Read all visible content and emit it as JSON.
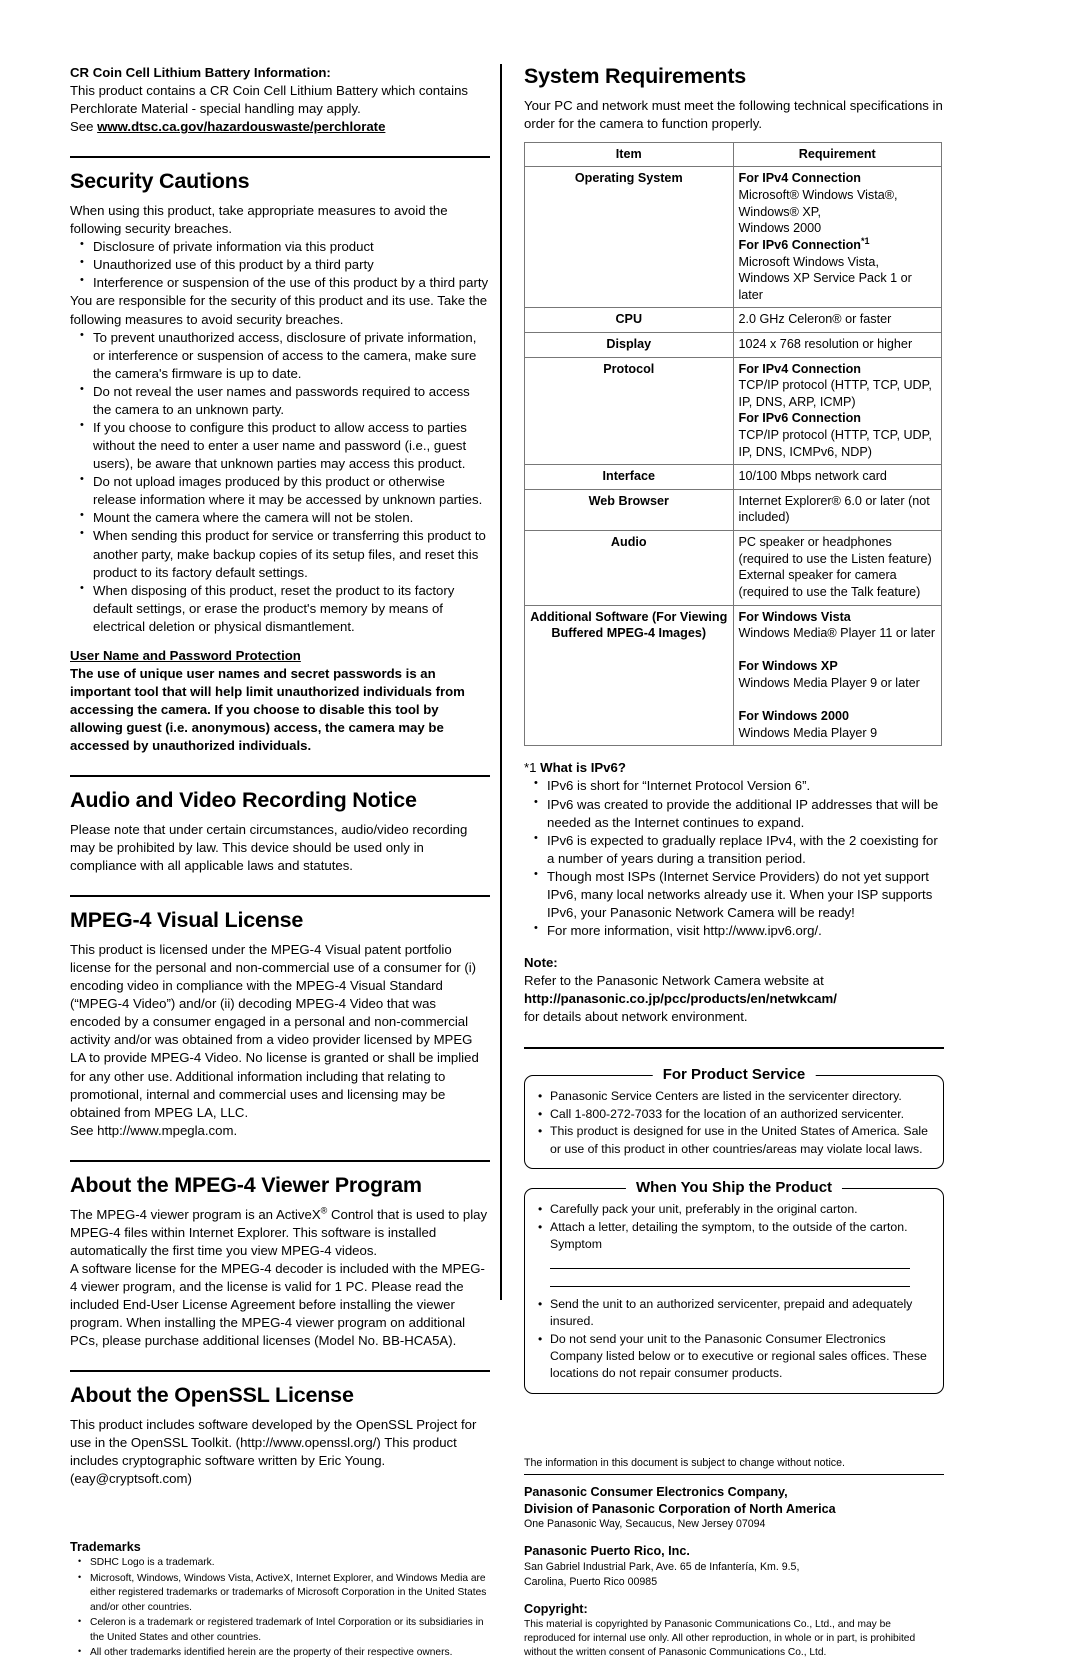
{
  "left_column": {
    "battery_notice": {
      "heading": "CR Coin Cell Lithium Battery Information:",
      "line1": "This product contains a CR Coin Cell Lithium Battery which contains",
      "line2": "Perchlorate Material - special handling may apply.",
      "see_label": "See ",
      "url": "www.dtsc.ca.gov/hazardouswaste/perchlorate"
    },
    "security_cautions": {
      "title": "Security Cautions",
      "intro": "When using this product, take appropriate measures to avoid the following security breaches.",
      "breaches": [
        "Disclosure of private information via this product",
        "Unauthorized use of this product by a third party",
        "Interference or suspension of the use of this product by a third party"
      ],
      "responsibility": "You are responsible for the security of this product and its use. Take the following measures to avoid security breaches.",
      "measures": [
        "To prevent unauthorized access, disclosure of private information, or interference or suspension of access to the camera, make sure the camera's firmware is up to date.",
        "Do not reveal the user names and passwords required to access the camera to an unknown party.",
        "If you choose to configure this product to allow access to parties without the need to enter a user name and password (i.e., guest users), be aware that unknown parties may access this product.",
        "Do not upload images produced by this product or otherwise release information where it may be accessed by unknown parties.",
        "Mount the camera where the camera will not be stolen.",
        "When sending this product for service or transferring this product to another party, make backup copies of its setup files, and reset this product to its factory default settings.",
        "When disposing of this product, reset the product to its factory default settings, or erase the product's memory by means of electrical deletion or physical dismantlement."
      ],
      "password_heading": "User Name and Password Protection",
      "password_body": "The use of unique user names and secret passwords is an important tool that will help limit unauthorized individuals from accessing the camera. If you choose to disable this tool by allowing guest (i.e. anonymous) access, the camera may be accessed by unauthorized individuals."
    },
    "av_recording": {
      "title": "Audio and Video Recording Notice",
      "body": "Please note that under certain circumstances, audio/video recording may be prohibited by law. This device should be used only in compliance with all applicable laws and statutes."
    },
    "mpeg4_license": {
      "title": "MPEG-4 Visual License",
      "body": "This product is licensed under the MPEG-4 Visual patent portfolio license for the personal and non-commercial use of a consumer for (i) encoding video in compliance with the MPEG-4 Visual Standard (“MPEG-4 Video”) and/or (ii) decoding MPEG-4 Video that was encoded by a consumer engaged in a personal and non-commercial activity and/or was obtained from a video provider licensed by MPEG LA to provide MPEG-4 Video. No license is granted or shall be implied for any other use. Additional information including that relating to promotional, internal and commercial uses and licensing may be obtained from MPEG LA, LLC.",
      "see": "See http://www.mpegla.com."
    },
    "mpeg4_viewer": {
      "title": "About the MPEG-4 Viewer Program",
      "para1_a": "The MPEG-4 viewer program is an ActiveX",
      "para1_b": " Control that is used to play MPEG-4 files within Internet Explorer. This software is installed automatically the first time you view MPEG-4 videos.",
      "para2": "A software license for the MPEG-4 decoder is included with the MPEG-4 viewer program, and the license is valid for 1 PC. Please read the included End-User License Agreement before installing the viewer program. When installing the MPEG-4 viewer program on additional PCs, please purchase additional licenses (Model No. BB-HCA5A)."
    },
    "openssl": {
      "title": "About the OpenSSL License",
      "body": "This product includes software developed by the OpenSSL Project for use in the OpenSSL Toolkit. (http://www.openssl.org/) This product includes cryptographic software written by Eric Young. (eay@cryptsoft.com)"
    },
    "trademarks": {
      "title": "Trademarks",
      "items": [
        "SDHC Logo is a trademark.",
        "Microsoft, Windows, Windows Vista, ActiveX, Internet Explorer, and Windows Media are either registered trademarks or trademarks of Microsoft Corporation in the United States and/or other countries.",
        "Celeron is a trademark or registered trademark of Intel Corporation or its subsidiaries in the United States and other countries.",
        "All other trademarks identified herein are the property of their respective owners."
      ]
    }
  },
  "right_column": {
    "system_requirements": {
      "title": "System Requirements",
      "intro": "Your PC and network must meet the following technical specifications in order for the camera to function properly.",
      "table": {
        "headers": [
          "Item",
          "Requirement"
        ],
        "rows": [
          {
            "item": "Operating System",
            "requirement_lines": [
              {
                "text": "For IPv4 Connection",
                "bold": true
              },
              {
                "text": "Microsoft® Windows Vista®, Windows® XP,",
                "bold": false
              },
              {
                "text": "Windows 2000",
                "bold": false
              },
              {
                "text": "For IPv6 Connection*1",
                "bold": true
              },
              {
                "text": "Microsoft Windows Vista,",
                "bold": false
              },
              {
                "text": "Windows XP Service Pack 1 or later",
                "bold": false
              }
            ]
          },
          {
            "item": "CPU",
            "requirement_lines": [
              {
                "text": "2.0 GHz Celeron® or faster",
                "bold": false
              }
            ]
          },
          {
            "item": "Display",
            "requirement_lines": [
              {
                "text": "1024 x 768 resolution or higher",
                "bold": false
              }
            ]
          },
          {
            "item": "Protocol",
            "requirement_lines": [
              {
                "text": "For IPv4 Connection",
                "bold": true
              },
              {
                "text": "TCP/IP protocol (HTTP, TCP, UDP, IP, DNS, ARP, ICMP)",
                "bold": false
              },
              {
                "text": "For IPv6 Connection",
                "bold": true
              },
              {
                "text": "TCP/IP protocol (HTTP, TCP, UDP, IP, DNS, ICMPv6, NDP)",
                "bold": false
              }
            ]
          },
          {
            "item": "Interface",
            "requirement_lines": [
              {
                "text": "10/100 Mbps network card",
                "bold": false
              }
            ]
          },
          {
            "item": "Web Browser",
            "requirement_lines": [
              {
                "text": "Internet Explorer® 6.0 or later (not included)",
                "bold": false
              }
            ]
          },
          {
            "item": "Audio",
            "requirement_lines": [
              {
                "text": "PC speaker or headphones (required to use the Listen feature)",
                "bold": false
              },
              {
                "text": "External speaker for camera (required to use the Talk feature)",
                "bold": false
              }
            ]
          },
          {
            "item": "Additional Software (For Viewing Buffered MPEG-4 Images)",
            "requirement_lines": [
              {
                "text": "For Windows Vista",
                "bold": true
              },
              {
                "text": "Windows Media® Player 11 or later",
                "bold": false
              },
              {
                "text": "",
                "bold": false
              },
              {
                "text": "For Windows XP",
                "bold": true
              },
              {
                "text": "Windows Media Player 9 or later",
                "bold": false
              },
              {
                "text": "",
                "bold": false
              },
              {
                "text": "For Windows 2000",
                "bold": true
              },
              {
                "text": "Windows Media Player 9",
                "bold": false
              }
            ]
          }
        ]
      },
      "footnote": {
        "marker": "*1",
        "heading": "What is IPv6?",
        "items": [
          "IPv6 is short for “Internet Protocol Version 6”.",
          "IPv6 was created to provide the additional IP addresses that will be needed as the Internet continues to expand.",
          "IPv6 is expected to gradually replace IPv4, with the 2 coexisting for a number of years during a transition period.",
          "Though most ISPs (Internet Service Providers) do not yet support IPv6, many local networks already use it. When your ISP supports IPv6, your Panasonic Network Camera will be ready!",
          "For more information, visit http://www.ipv6.org/."
        ]
      },
      "note": {
        "label": "Note:",
        "line1": "Refer to the Panasonic Network Camera website at",
        "url": "http://panasonic.co.jp/pcc/products/en/netwkcam/",
        "line2": "for details about network environment."
      }
    },
    "product_service": {
      "title": "For Product Service",
      "items": [
        "Panasonic Service Centers are listed in the servicenter directory.",
        "Call 1-800-272-7033 for the location of an authorized servicenter.",
        "This product is designed for use in the United States of America. Sale or use of this product in other countries/areas may violate local laws."
      ]
    },
    "ship_product": {
      "title": "When You Ship the Product",
      "items_top": [
        "Carefully pack your unit, preferably in the original carton.",
        "Attach a letter, detailing the symptom, to the outside of the carton."
      ],
      "symptom_label": "Symptom",
      "items_bottom": [
        "Send the unit to an authorized servicenter, prepaid and adequately insured.",
        "Do not send your unit to the Panasonic Consumer Electronics Company listed below or to executive or regional sales offices. These locations do not repair consumer products."
      ]
    },
    "footer": {
      "notice": "The information in this document is subject to change without notice.",
      "company1_line1": "Panasonic Consumer Electronics Company,",
      "company1_line2": "Division of Panasonic Corporation of North America",
      "company1_address": "One Panasonic Way, Secaucus, New Jersey 07094",
      "company2_name": "Panasonic Puerto Rico, Inc.",
      "company2_address_line1": "San Gabriel Industrial Park, Ave. 65 de Infantería, Km. 9.5,",
      "company2_address_line2": "Carolina, Puerto Rico 00985",
      "copyright_label": "Copyright:",
      "copyright_body": "This material is copyrighted by Panasonic Communications Co., Ltd., and may be reproduced for internal use only. All other reproduction, in whole or in part, is prohibited without the written consent of Panasonic Communications Co., Ltd."
    }
  }
}
